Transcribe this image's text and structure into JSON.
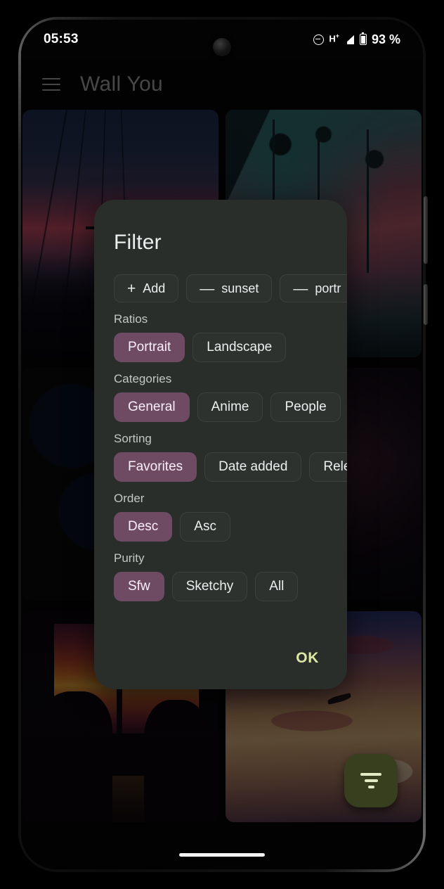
{
  "status_bar": {
    "time": "05:53",
    "dnd_icon": "do-not-disturb-icon",
    "network_type": "H",
    "network_sup": "+",
    "signal_icon": "signal-bars-icon",
    "battery_icon": "battery-icon",
    "battery_level": "93 %"
  },
  "app_bar": {
    "menu_icon": "hamburger-menu-icon",
    "title": "Wall You"
  },
  "grid": {
    "items": [
      {
        "name": "wallpaper-powerlines-sunset"
      },
      {
        "name": "wallpaper-palm-trees-sunset"
      },
      {
        "name": "wallpaper-stormy-blue-clouds"
      },
      {
        "name": "wallpaper-dark-scene"
      },
      {
        "name": "wallpaper-window-silhouettes"
      },
      {
        "name": "wallpaper-sunset-clouds-plane"
      }
    ]
  },
  "fab": {
    "icon": "filter-funnel-icon",
    "color": "#373f1e"
  },
  "dialog": {
    "title": "Filter",
    "tags": [
      {
        "glyph": "+",
        "label": "Add",
        "action": "add"
      },
      {
        "glyph": "—",
        "label": "sunset",
        "action": "remove"
      },
      {
        "glyph": "—",
        "label": "portr",
        "action": "remove"
      }
    ],
    "sections": [
      {
        "label": "Ratios",
        "options": [
          {
            "label": "Portrait",
            "selected": true
          },
          {
            "label": "Landscape",
            "selected": false
          }
        ]
      },
      {
        "label": "Categories",
        "options": [
          {
            "label": "General",
            "selected": true
          },
          {
            "label": "Anime",
            "selected": false
          },
          {
            "label": "People",
            "selected": false
          }
        ]
      },
      {
        "label": "Sorting",
        "options": [
          {
            "label": "Favorites",
            "selected": true
          },
          {
            "label": "Date added",
            "selected": false
          },
          {
            "label": "Rele",
            "selected": false
          }
        ]
      },
      {
        "label": "Order",
        "options": [
          {
            "label": "Desc",
            "selected": true
          },
          {
            "label": "Asc",
            "selected": false
          }
        ]
      },
      {
        "label": "Purity",
        "options": [
          {
            "label": "Sfw",
            "selected": true
          },
          {
            "label": "Sketchy",
            "selected": false
          },
          {
            "label": "All",
            "selected": false
          }
        ]
      }
    ],
    "ok_label": "OK",
    "selected_chip_color": "#6f4a63",
    "ok_color": "#dbe9a4",
    "background_color": "#292e2a"
  },
  "nav_bar": {
    "pill": "gesture-home-pill"
  }
}
